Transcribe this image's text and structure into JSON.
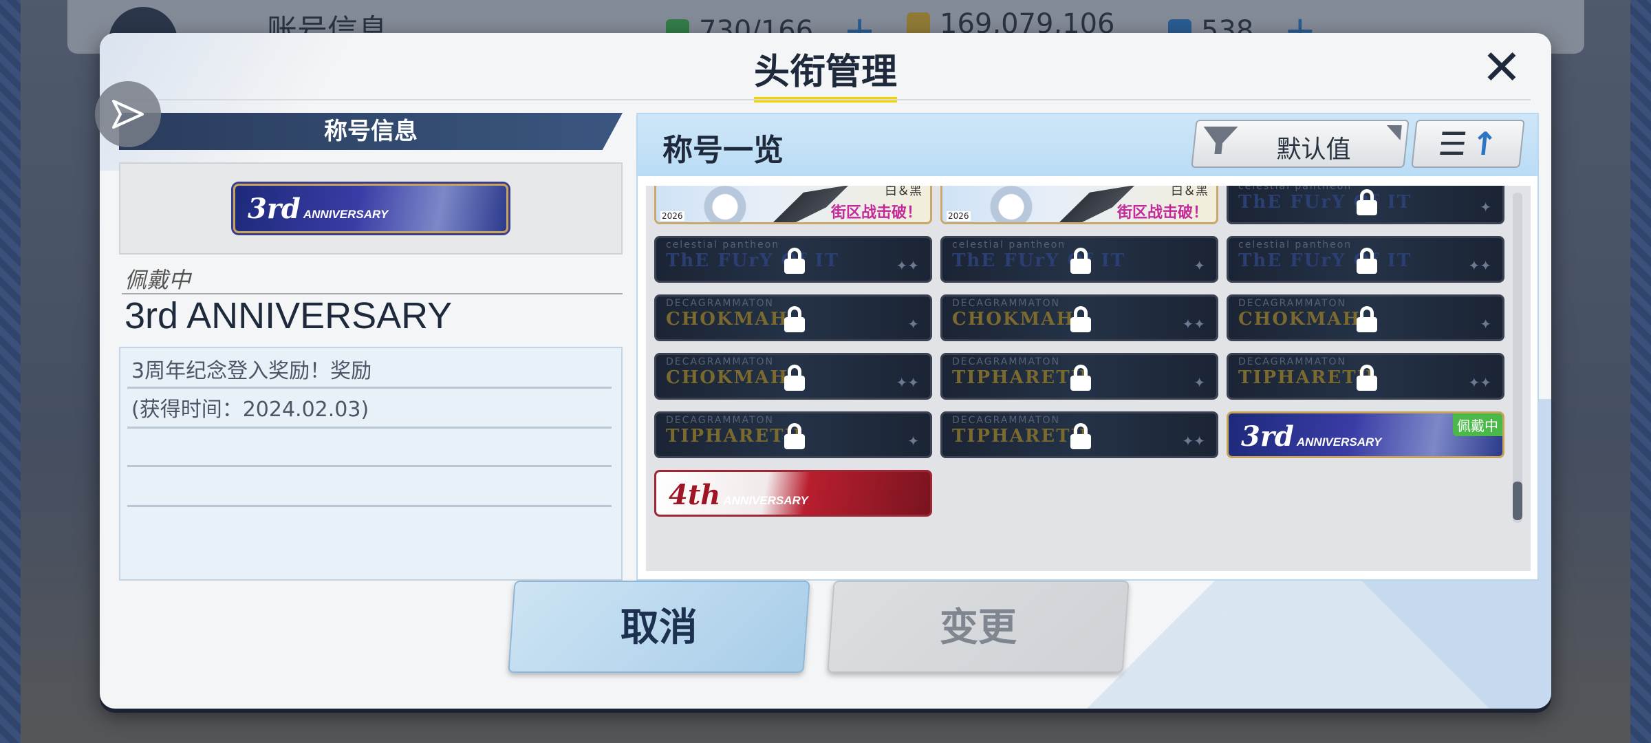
{
  "background": {
    "top_title": "账号信息",
    "resources": [
      {
        "icon": "stamina-icon",
        "value": "730/166",
        "color": "#3cb84a",
        "has_plus": true
      },
      {
        "icon": "credit-card-icon",
        "value": "169,079,106",
        "color": "#e6b52a",
        "has_plus": false
      },
      {
        "icon": "crystal-icon",
        "value": "538",
        "color": "#2a7fd0",
        "has_plus": true
      }
    ]
  },
  "dialog": {
    "title": "头衔管理",
    "close_icon": "close-icon",
    "left": {
      "header": "称号信息",
      "preview_badge": {
        "main": "3rd",
        "sub": "ANNIVERSARY"
      },
      "wearing_label": "佩戴中",
      "title_name": "3rd ANNIVERSARY",
      "description": [
        "3周年纪念登入奖励！奖励",
        "(获得时间：2024.02.03)",
        "",
        "",
        ""
      ]
    },
    "right": {
      "header": "称号一览",
      "sort_label": "默认值",
      "badges": [
        {
          "type": "event",
          "top": "白＆黑",
          "text": "街区战击破！",
          "year": "2026",
          "locked": false
        },
        {
          "type": "event",
          "top": "白＆黑",
          "text": "街区战击破！",
          "year": "2026",
          "locked": false
        },
        {
          "type": "locked",
          "small": "celestial pantheon",
          "text": "ThE FUrY Of IT",
          "color": "#2b3f72",
          "pips": "✦",
          "locked": true
        },
        {
          "type": "locked",
          "small": "celestial pantheon",
          "text": "ThE FUrY Of IT",
          "color": "#2b3f72",
          "pips": "✦✦",
          "locked": true
        },
        {
          "type": "locked",
          "small": "celestial pantheon",
          "text": "ThE FUrY Of IT",
          "color": "#2b3f72",
          "pips": "✦",
          "locked": true
        },
        {
          "type": "locked",
          "small": "celestial pantheon",
          "text": "ThE FUrY Of IT",
          "color": "#2b3f72",
          "pips": "✦✦",
          "locked": true
        },
        {
          "type": "locked",
          "small": "DECAGRAMMATON",
          "text": "CHOKMAH",
          "color": "#7a6a2e",
          "pips": "✦",
          "locked": true
        },
        {
          "type": "locked",
          "small": "DECAGRAMMATON",
          "text": "CHOKMAH",
          "color": "#7a6a2e",
          "pips": "✦✦",
          "locked": true
        },
        {
          "type": "locked",
          "small": "DECAGRAMMATON",
          "text": "CHOKMAH",
          "color": "#7a6a2e",
          "pips": "✦",
          "locked": true
        },
        {
          "type": "locked",
          "small": "DECAGRAMMATON",
          "text": "CHOKMAH",
          "color": "#7a6a2e",
          "pips": "✦✦",
          "locked": true
        },
        {
          "type": "locked",
          "small": "DECAGRAMMATON",
          "text": "TIPHARETH",
          "color": "#7a6a2e",
          "pips": "✦",
          "locked": true
        },
        {
          "type": "locked",
          "small": "DECAGRAMMATON",
          "text": "TIPHARETH",
          "color": "#7a6a2e",
          "pips": "✦✦",
          "locked": true
        },
        {
          "type": "locked",
          "small": "DECAGRAMMATON",
          "text": "TIPHARETH",
          "color": "#7a6a2e",
          "pips": "✦",
          "locked": true
        },
        {
          "type": "locked",
          "small": "DECAGRAMMATON",
          "text": "TIPHARETH",
          "color": "#7a6a2e",
          "pips": "✦✦",
          "locked": true
        },
        {
          "type": "anniv3",
          "main": "3rd",
          "sub": "ANNIVERSARY",
          "tag": "佩戴中",
          "locked": false
        },
        {
          "type": "anniv4",
          "main": "4th",
          "sub": "ANNIVERSARY",
          "locked": false
        }
      ]
    },
    "buttons": {
      "cancel": "取消",
      "change": "变更"
    }
  }
}
